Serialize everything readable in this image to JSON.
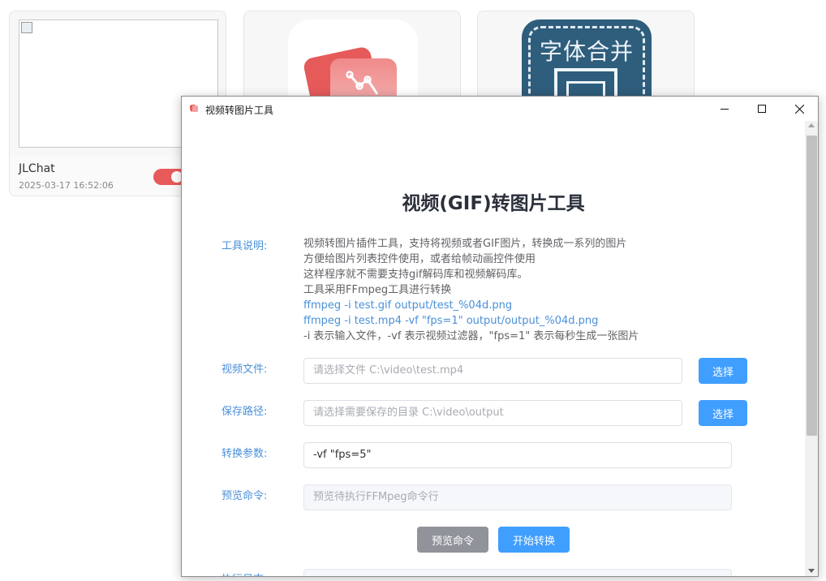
{
  "cards": [
    {
      "name": "JLChat",
      "time": "2025-03-17 16:52:06",
      "toggle_on": true,
      "toggle_color": "#e85a5a"
    },
    {
      "icon": "chart-app-icon"
    },
    {
      "icon_text": "字体合并"
    }
  ],
  "window": {
    "title": "视频转图片工具",
    "controls": {
      "minimize": "minimize-icon",
      "maximize": "maximize-icon",
      "close": "close-icon"
    }
  },
  "main": {
    "heading": "视频(GIF)转图片工具",
    "description": {
      "label": "工具说明:",
      "lines": [
        "视频转图片插件工具，支持将视频或者GIF图片，转换成一系列的图片",
        "方便给图片列表控件使用，或者给帧动画控件使用",
        "这样程序就不需要支持gif解码库和视频解码库。",
        "工具采用FFmpeg工具进行转换",
        "ffmpeg -i test.gif output/test_%04d.png",
        "ffmpeg -i test.mp4 -vf \"fps=1\" output/output_%04d.png",
        "-i 表示输入文件，-vf 表示视频过滤器，\"fps=1\" 表示每秒生成一张图片"
      ]
    },
    "video_file": {
      "label": "视频文件:",
      "placeholder": "请选择文件 C:\\video\\test.mp4",
      "button": "选择"
    },
    "save_path": {
      "label": "保存路径:",
      "placeholder": "请选择需要保存的目录 C:\\video\\output",
      "button": "选择"
    },
    "params": {
      "label": "转换参数:",
      "value": "-vf \"fps=5\""
    },
    "preview": {
      "label": "预览命令:",
      "placeholder": "预览待执行FFMpeg命令行"
    },
    "actions": {
      "preview_button": "预览命令",
      "start_button": "开始转换"
    },
    "log": {
      "label": "执行日志:"
    }
  },
  "colors": {
    "accent": "#409eff",
    "label": "#4a90d9",
    "gray_button": "#909399"
  }
}
